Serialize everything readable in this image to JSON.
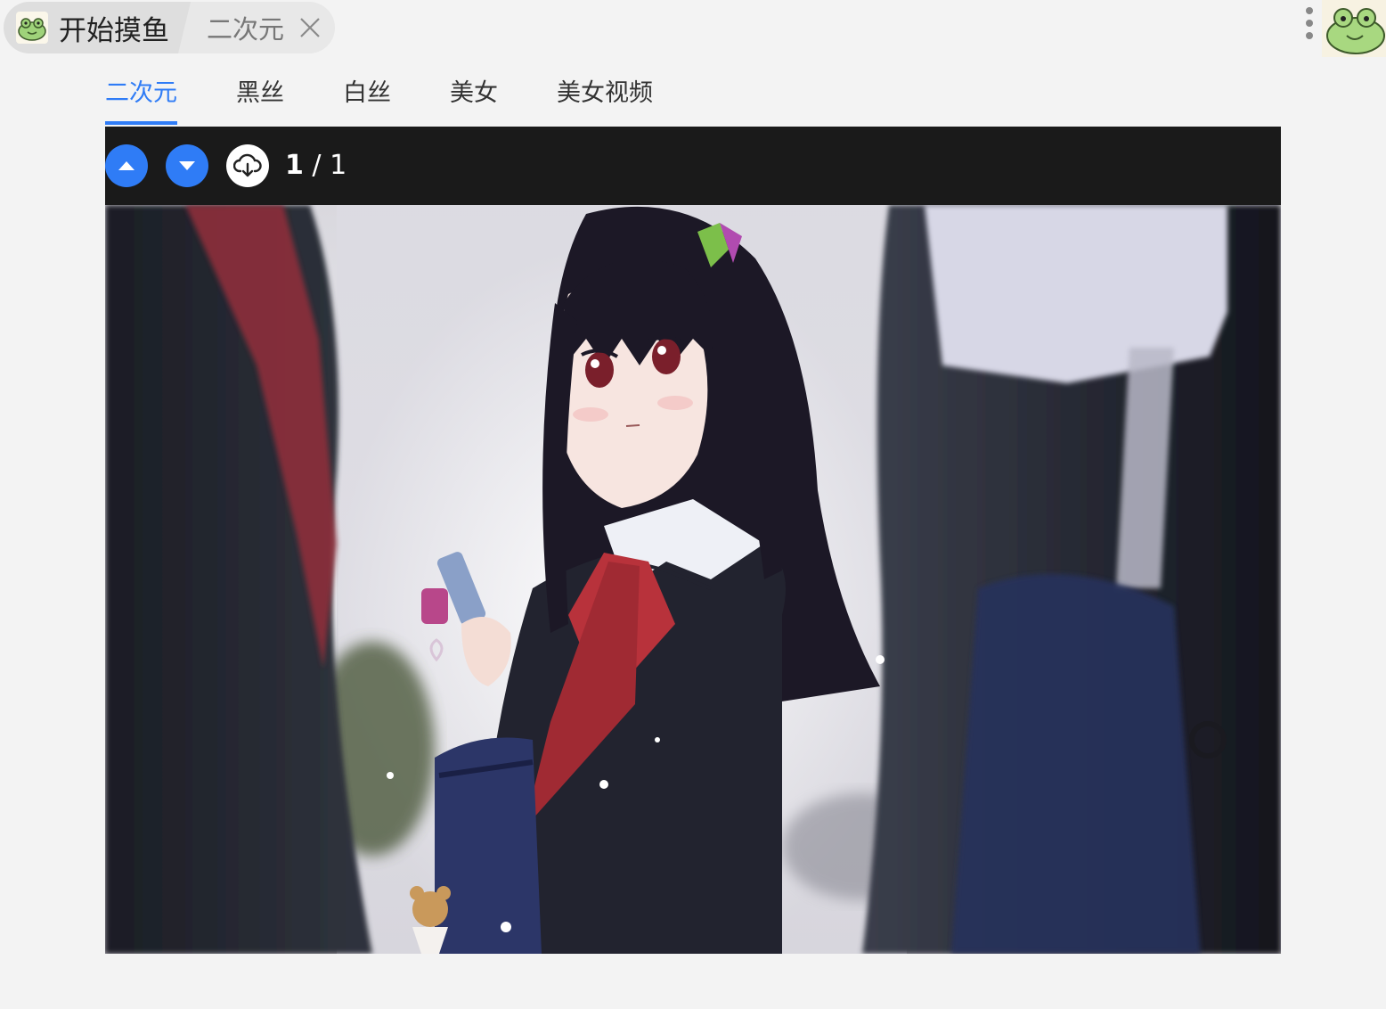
{
  "header": {
    "home_tab_label": "开始摸鱼",
    "sub_tab_label": "二次元"
  },
  "categories": [
    {
      "label": "二次元",
      "active": true
    },
    {
      "label": "黑丝",
      "active": false
    },
    {
      "label": "白丝",
      "active": false
    },
    {
      "label": "美女",
      "active": false
    },
    {
      "label": "美女视频",
      "active": false
    }
  ],
  "viewer": {
    "current_page": "1",
    "separator": "/",
    "total_pages": "1"
  },
  "colors": {
    "accent": "#2f7cf6",
    "toolbar_bg": "#1a1a1a",
    "page_bg": "#f3f3f3"
  },
  "icons": {
    "home": "frog-icon",
    "close": "close-icon",
    "menu": "kebab-menu-icon",
    "avatar": "frog-avatar",
    "up": "arrow-up-icon",
    "down": "arrow-down-icon",
    "download": "cloud-download-icon"
  }
}
